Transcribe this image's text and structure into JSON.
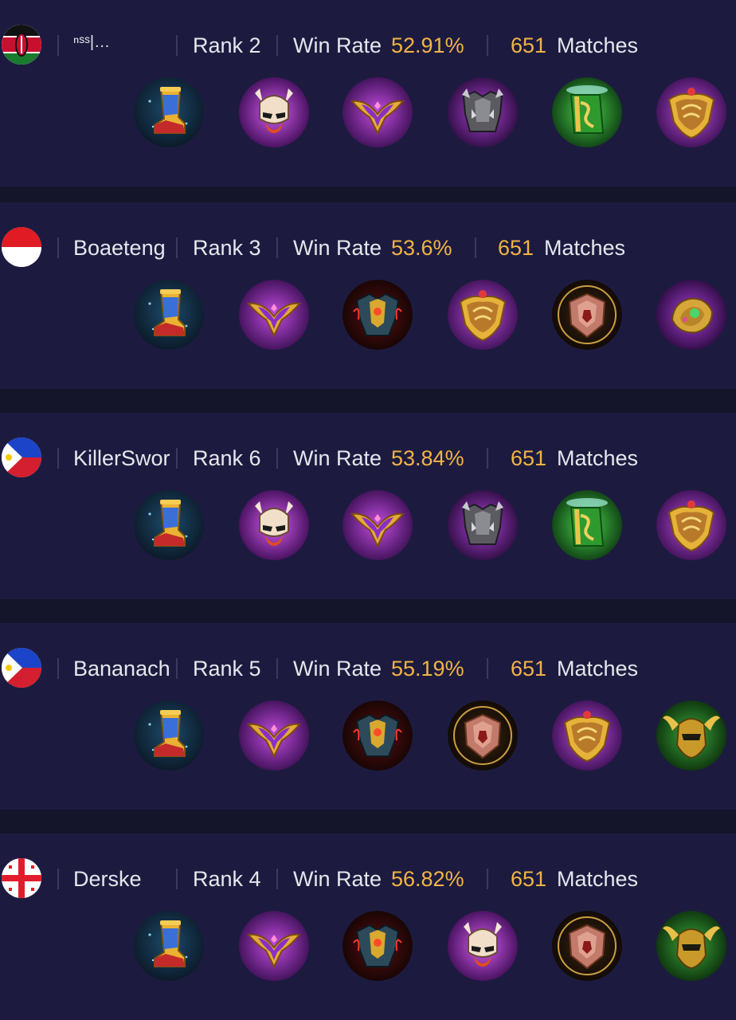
{
  "rows": [
    {
      "flag": "kenya-flag",
      "name": "ⁿˢˢ|…",
      "rank_label": "Rank 2",
      "win_rate_label": "Win Rate",
      "win_rate": "52.91%",
      "matches_count": "651",
      "matches_label": "Matches",
      "items": [
        "boots-icon",
        "skull-mask-icon",
        "purple-wings-icon",
        "iron-armor-icon",
        "green-tome-icon",
        "golden-shield-icon"
      ]
    },
    {
      "flag": "indonesia-flag",
      "name": "Boaeteng",
      "rank_label": "Rank 3",
      "win_rate_label": "Win Rate",
      "win_rate": "53.6%",
      "matches_count": "651",
      "matches_label": "Matches",
      "items": [
        "boots-icon",
        "purple-wings-icon",
        "dragon-armor-icon",
        "golden-shield-icon",
        "bronze-shield-icon",
        "gem-gauntlet-icon"
      ]
    },
    {
      "flag": "philippines-flag",
      "name": "KillerSwor",
      "rank_label": "Rank 6",
      "win_rate_label": "Win Rate",
      "win_rate": "53.84%",
      "matches_count": "651",
      "matches_label": "Matches",
      "items": [
        "boots-icon",
        "skull-mask-icon",
        "purple-wings-icon",
        "iron-armor-icon",
        "green-tome-icon",
        "golden-shield-icon"
      ]
    },
    {
      "flag": "philippines-flag",
      "name": "Bananach",
      "rank_label": "Rank 5",
      "win_rate_label": "Win Rate",
      "win_rate": "55.19%",
      "matches_count": "651",
      "matches_label": "Matches",
      "items": [
        "boots-icon",
        "purple-wings-icon",
        "dragon-armor-icon",
        "bronze-shield-icon",
        "golden-shield-icon",
        "winged-helm-icon"
      ]
    },
    {
      "flag": "georgia-flag",
      "name": "Derske",
      "rank_label": "Rank 4",
      "win_rate_label": "Win Rate",
      "win_rate": "56.82%",
      "matches_count": "651",
      "matches_label": "Matches",
      "items": [
        "boots-icon",
        "purple-wings-icon",
        "dragon-armor-icon",
        "skull-mask-icon",
        "bronze-shield-icon",
        "winged-helm-icon"
      ]
    }
  ],
  "colors": {
    "card_bg": "#1c1b3f",
    "page_bg": "#14142b",
    "accent_gold": "#f2b444",
    "text": "#e6e6ee"
  }
}
